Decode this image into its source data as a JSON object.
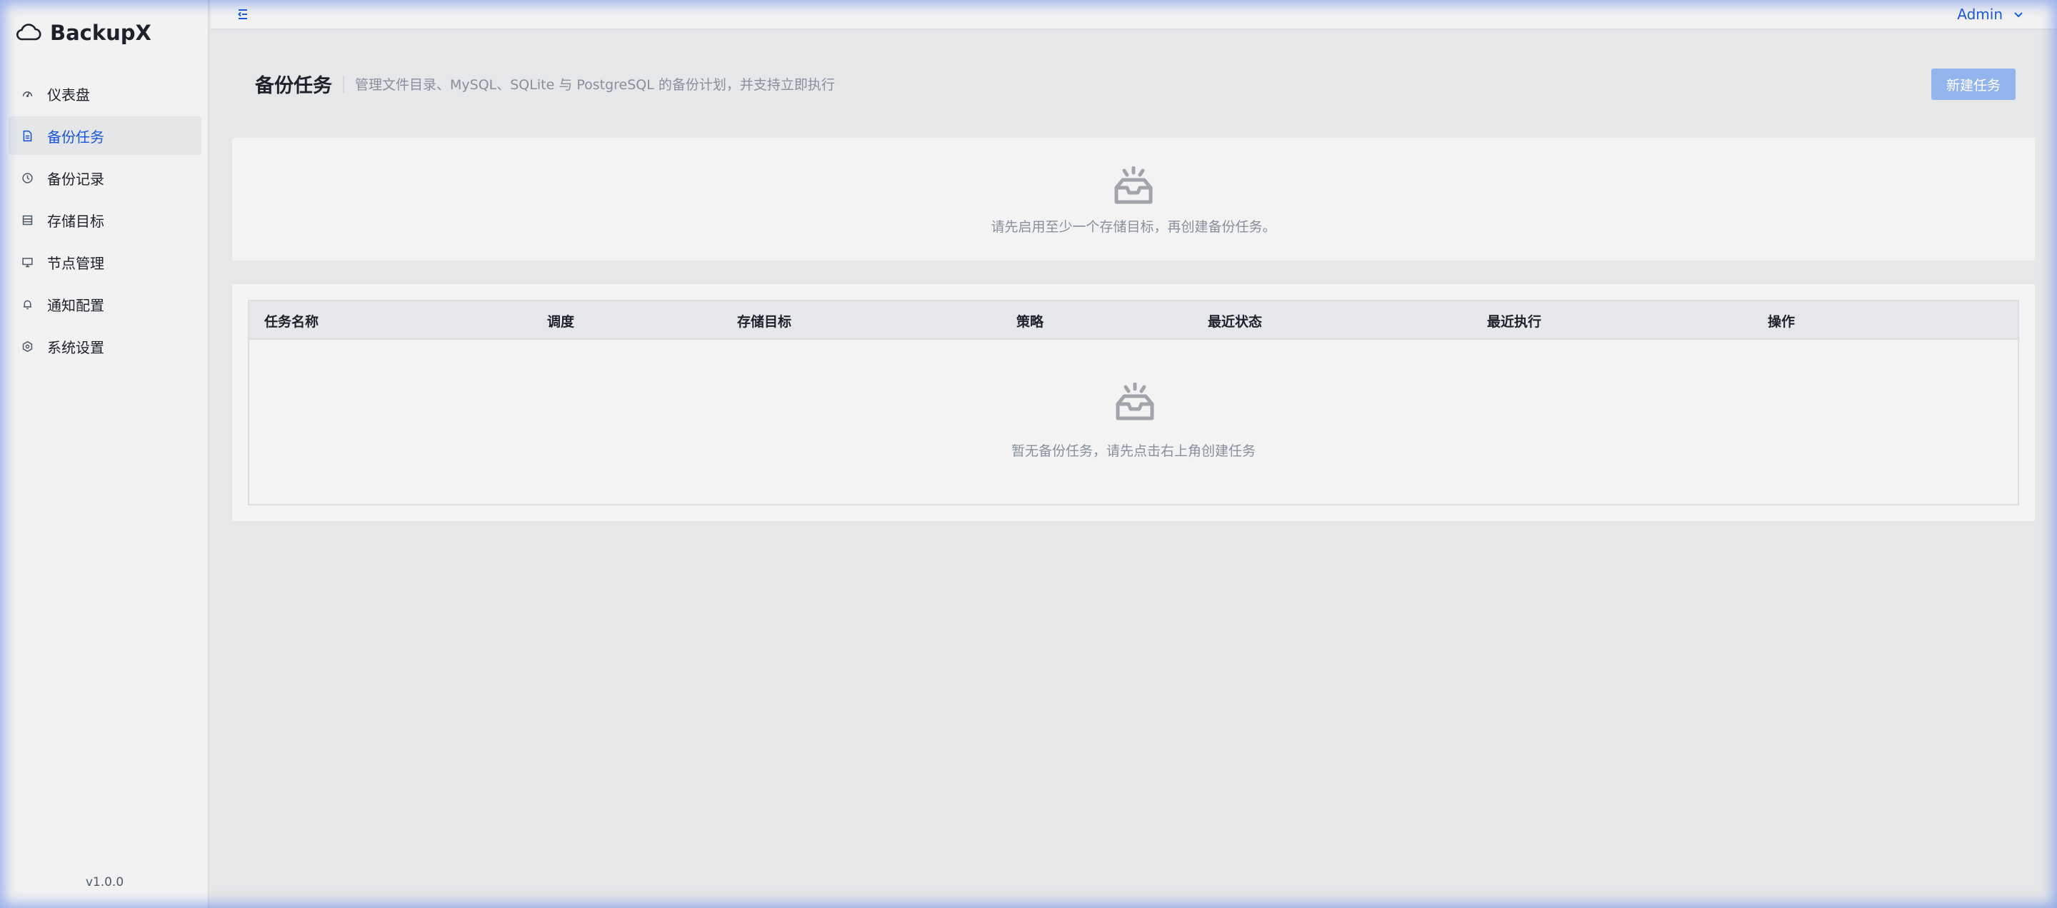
{
  "app": {
    "name": "BackupX",
    "version": "v1.0.0"
  },
  "sidebar": {
    "items": [
      {
        "label": "仪表盘",
        "icon": "dashboard-icon",
        "active": false
      },
      {
        "label": "备份任务",
        "icon": "file-icon",
        "active": true
      },
      {
        "label": "备份记录",
        "icon": "history-icon",
        "active": false
      },
      {
        "label": "存储目标",
        "icon": "storage-icon",
        "active": false
      },
      {
        "label": "节点管理",
        "icon": "monitor-icon",
        "active": false
      },
      {
        "label": "通知配置",
        "icon": "bell-icon",
        "active": false
      },
      {
        "label": "系统设置",
        "icon": "settings-icon",
        "active": false
      }
    ]
  },
  "header": {
    "user": "Admin",
    "collapse_icon": "menu-fold-icon",
    "user_menu_icon": "chevron-down-icon"
  },
  "page": {
    "title": "备份任务",
    "description": "管理文件目录、MySQL、SQLite 与 PostgreSQL 的备份计划，并支持立即执行",
    "new_button": "新建任务"
  },
  "notice": {
    "icon": "empty-inbox-icon",
    "text": "请先启用至少一个存储目标，再创建备份任务。"
  },
  "table": {
    "columns": [
      "任务名称",
      "调度",
      "存储目标",
      "策略",
      "最近状态",
      "最近执行",
      "操作"
    ],
    "rows": [],
    "empty_text": "暂无备份任务，请先点击右上角创建任务"
  },
  "colors": {
    "accent": "#1a56db",
    "button_disabled": "#94b4ee",
    "background": "#e6e7e9",
    "card": "#f3f3f3"
  }
}
